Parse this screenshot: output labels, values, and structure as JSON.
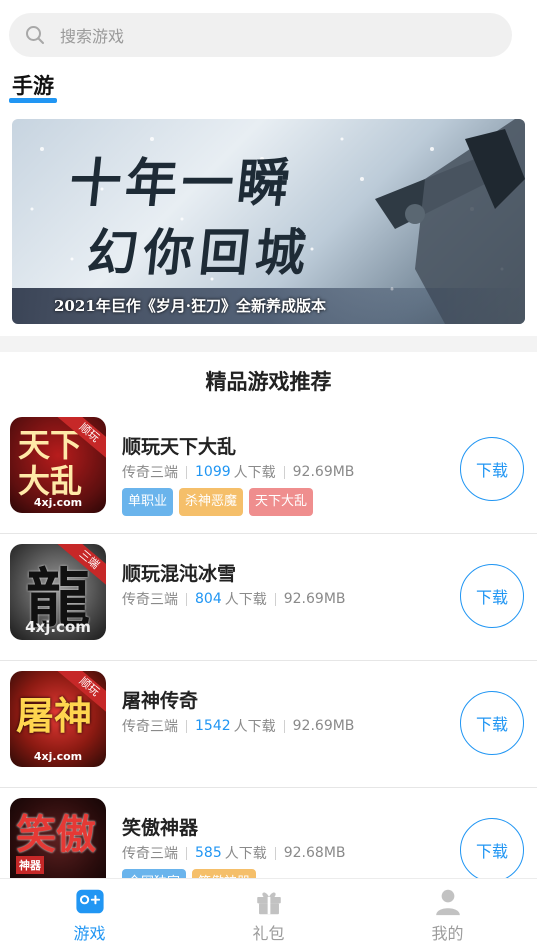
{
  "search": {
    "placeholder": "搜索游戏"
  },
  "section": {
    "title": "手游"
  },
  "banner": {
    "line1": "十年一瞬",
    "line2": "幻你回城",
    "line3": "2021年巨作《岁月·狂刀》全新养成版本"
  },
  "recommend": {
    "title": "精品游戏推荐"
  },
  "games": [
    {
      "name": "顺玩天下大乱",
      "category": "传奇三端",
      "downloads": "1099",
      "downloads_suffix": "人下载",
      "size": "92.69MB",
      "icon": {
        "ribbon": "顺玩",
        "big": "天下大乱",
        "site": "4xj.com"
      },
      "tags": [
        {
          "label": "单职业",
          "color": "#6ab4ec"
        },
        {
          "label": "杀神恶魔",
          "color": "#f5bf6a"
        },
        {
          "label": "天下大乱",
          "color": "#ef8e8e"
        }
      ],
      "download_label": "下载"
    },
    {
      "name": "顺玩混沌冰雪",
      "category": "传奇三端",
      "downloads": "804",
      "downloads_suffix": "人下载",
      "size": "92.69MB",
      "icon": {
        "ribbon": "三端",
        "big": "龍",
        "site": "4xj.com"
      },
      "tags": [],
      "download_label": "下载"
    },
    {
      "name": "屠神传奇",
      "category": "传奇三端",
      "downloads": "1542",
      "downloads_suffix": "人下载",
      "size": "92.69MB",
      "icon": {
        "ribbon": "顺玩",
        "big": "屠神",
        "site": "4xj.com"
      },
      "tags": [],
      "download_label": "下载"
    },
    {
      "name": "笑傲神器",
      "category": "传奇三端",
      "downloads": "585",
      "downloads_suffix": "人下载",
      "size": "92.68MB",
      "icon": {
        "ribbon": "",
        "big": "笑傲",
        "site": "神器"
      },
      "tags": [
        {
          "label": "全网独家",
          "color": "#6ab4ec"
        },
        {
          "label": "笑傲神器",
          "color": "#f5bf6a"
        }
      ],
      "download_label": "下载"
    }
  ],
  "tabbar": {
    "tabs": [
      {
        "label": "游戏",
        "icon": "gamepad-icon",
        "active": true
      },
      {
        "label": "礼包",
        "icon": "gift-icon",
        "active": false
      },
      {
        "label": "我的",
        "icon": "user-icon",
        "active": false
      }
    ]
  },
  "colors": {
    "accent": "#2196f3",
    "divider": "#f3f3f3"
  }
}
